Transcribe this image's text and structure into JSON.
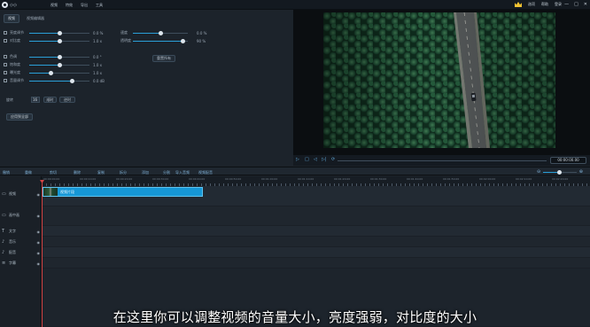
{
  "app": {
    "title": "小小"
  },
  "menu": {
    "items": [
      "视频",
      "特效",
      "导出",
      "工具"
    ]
  },
  "top_right": {
    "items": [
      "选项",
      "帮助",
      "登录"
    ]
  },
  "window_controls": {
    "minimize": "—",
    "maximize": "□",
    "close": "✕"
  },
  "panel": {
    "tabs": [
      "视频",
      "视频编辑器"
    ],
    "rows": [
      {
        "label": "亮度调节",
        "value": "0.0 %",
        "level": 0.5
      },
      {
        "label": "对比度",
        "value": "1.0 x",
        "level": 0.5
      },
      {
        "label": "色调",
        "value": "0.0 °",
        "level": 0.5
      },
      {
        "label": "饱和度",
        "value": "1.0 x",
        "level": 0.5
      },
      {
        "label": "曝光度",
        "value": "1.0 x",
        "level": 0.35
      },
      {
        "label": "音量调节",
        "value": "0.0 dB",
        "level": 0.7
      }
    ],
    "right_rows": [
      {
        "label": "速度",
        "value": "0.0 %",
        "level": 0.5
      },
      {
        "label": "透明度",
        "value": "90 %",
        "level": 0.9
      }
    ],
    "reset_button": "重置所有",
    "rotation": {
      "label": "旋转",
      "value": "16",
      "clockwise": "顺时",
      "reverse": "逆时"
    },
    "apply_button": "应用到全部"
  },
  "player": {
    "timecode": "00:00:00.00",
    "controls": [
      "▷",
      "□",
      "◁",
      "▷|",
      "⟳"
    ]
  },
  "timeline_toolbar": {
    "tools": [
      "撤销",
      "重做",
      "剪切",
      "删除",
      "复制",
      "拆分",
      "添加",
      "分割",
      "导入音频",
      "视频配音"
    ],
    "zoom_out": "⊖",
    "zoom_in": "⊕"
  },
  "ruler": {
    "labels": [
      "00:00:00.00",
      "00:00:10.00",
      "00:00:20.00",
      "00:00:30.00",
      "00:00:40.00",
      "00:00:50.00",
      "00:01:00.00",
      "00:01:10.00",
      "00:01:20.00",
      "00:01:30.00",
      "00:01:40.00",
      "00:01:50.00",
      "00:02:00.00",
      "00:02:10.00",
      "00:02:20.00"
    ]
  },
  "tracks": [
    {
      "icon": "▭",
      "name": "视频"
    },
    {
      "icon": "▭",
      "name": "画中画"
    },
    {
      "icon": "T",
      "name": "文字"
    },
    {
      "icon": "♪",
      "name": "音乐"
    },
    {
      "icon": "♪",
      "name": "配音"
    },
    {
      "icon": "≡",
      "name": "字幕"
    }
  ],
  "clip": {
    "name": "视频片段"
  },
  "subtitle": "在这里你可以调整视频的音量大小，亮度强弱，对比度的大小",
  "colors": {
    "accent": "#1697d6",
    "playhead": "#d64545",
    "background": "#1b2128"
  }
}
